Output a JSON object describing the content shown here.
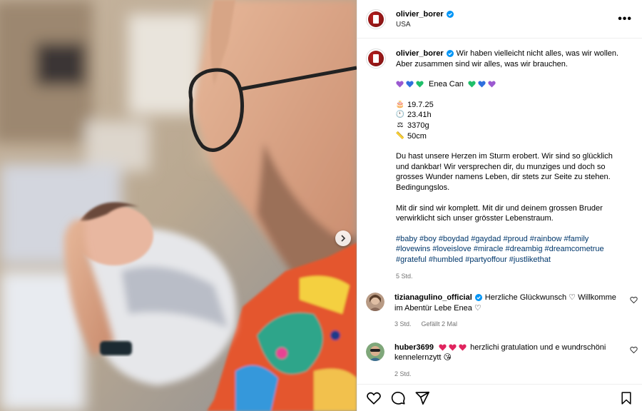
{
  "post": {
    "username": "olivier_borer",
    "location": "USA"
  },
  "caption": {
    "username": "olivier_borer",
    "text1": "Wir haben vielleicht nicht alles, was wir wollen. Aber zusammen sind wir alles, was wir brauchen.",
    "name": "Enea Can",
    "date": "19.7.25",
    "time": "23.41h",
    "weight": "3370g",
    "length": "50cm",
    "text2": "Du hast unsere Herzen im Sturm erobert. Wir sind so glücklich und dankbar! Wir versprechen dir, du munziges und doch so grosses Wunder namens Leben, dir stets zur Seite zu stehen. Bedingungslos.",
    "text3": "Mit dir sind wir komplett. Mit dir und deinem grossen Bruder verwirklicht sich unser grösster Lebenstraum.",
    "hashtags": "#baby #boy #boydad #gaydad #proud #rainbow #family #lovewins #loveislove #miracle #dreambig #dreamcometrue #grateful #humbled #partyoffour #justlikethat",
    "age": "5 Std."
  },
  "comments": [
    {
      "username": "tizianagulino_official",
      "verified": true,
      "text": "Herzliche Glückwunsch ♡ Willkomme im Abentür Lebe Enea ♡",
      "age": "3 Std.",
      "likes": "Gefällt 2 Mal"
    },
    {
      "username": "huber3699",
      "verified": false,
      "text": "herzlichi gratulation und e wundrschöni kennelernzytt",
      "emoji_end": "😘",
      "age": "2 Std."
    }
  ],
  "icons": {
    "heart_colors": [
      "#9b59d0",
      "#2f6fde",
      "#1fbf6a"
    ],
    "verified_color": "#0095f6"
  }
}
